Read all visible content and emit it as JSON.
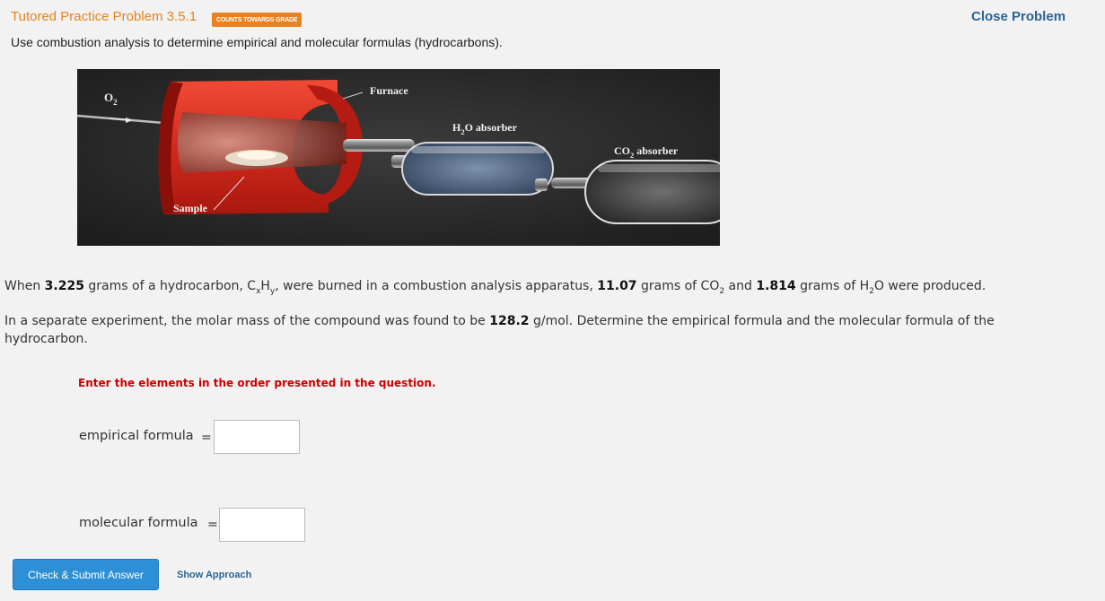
{
  "header": {
    "title": "Tutored Practice Problem 3.5.1",
    "badge": "COUNTS TOWARDS GRADE",
    "close_label": "Close Problem",
    "subtitle": "Use combustion analysis to determine empirical and molecular formulas (hydrocarbons)."
  },
  "figure": {
    "o2_label": "O",
    "o2_sub": "2",
    "furnace_label": "Furnace",
    "h2o_pre": "H",
    "h2o_sub": "2",
    "h2o_post": "O absorber",
    "co2_pre": "CO",
    "co2_sub": "2",
    "co2_post": " absorber",
    "sample_label": "Sample"
  },
  "problem": {
    "p1_a": "When ",
    "mass_sample": "3.225",
    "p1_b": " grams of a hydrocarbon, C",
    "sub_x": "x",
    "p1_c": "H",
    "sub_y": "y",
    "p1_d": ", were burned in a combustion analysis apparatus, ",
    "mass_co2": "11.07",
    "p1_e": " grams of CO",
    "sub_2a": "2",
    "p1_f": " and ",
    "mass_h2o": "1.814",
    "p1_g": " grams of H",
    "sub_2b": "2",
    "p1_h": "O were produced.",
    "p2_a": "In a separate experiment, the molar mass of the compound was found to be ",
    "molar_mass": "128.2",
    "p2_b": " g/mol. Determine the empirical formula and the molecular formula of the hydrocarbon.",
    "instruction": "Enter the elements in the order presented in the question."
  },
  "form": {
    "empirical_label": "empirical formula",
    "molecular_label": "molecular formula",
    "equals": "=",
    "empirical_value": "",
    "molecular_value": ""
  },
  "actions": {
    "submit_label": "Check & Submit Answer",
    "approach_label": "Show Approach"
  },
  "colors": {
    "title": "#e8821e",
    "link": "#2a6496",
    "instruction": "#cc0000",
    "button": "#2d8fd5",
    "furnace": "#d42a1e"
  }
}
